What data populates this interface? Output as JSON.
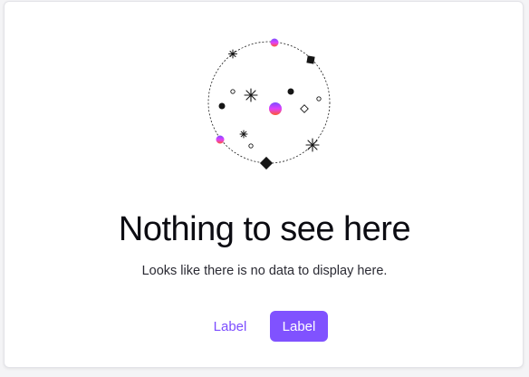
{
  "empty_state": {
    "title": "Nothing to see here",
    "message": "Looks like there is no data to display here.",
    "secondary_button_label": "Label",
    "primary_button_label": "Label",
    "illustration_icon": "empty-orbit-illustration"
  },
  "colors": {
    "accent": "#8052ff",
    "accent_text": "#7c4dff",
    "gradient_start": "#e040fb",
    "gradient_end": "#ff4a3d",
    "ink": "#0c0c12"
  }
}
